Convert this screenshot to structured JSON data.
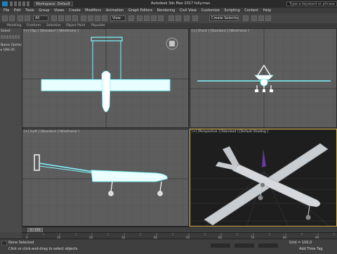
{
  "title_bar": {
    "workspace": "Workspace: Default",
    "app_title": "Autodesk 3ds Max 2017    fully.max",
    "search_placeholder": "Type a keyword or phrase"
  },
  "menu": [
    "File",
    "Edit",
    "Tools",
    "Group",
    "Views",
    "Create",
    "Modifiers",
    "Animation",
    "Graph Editors",
    "Rendering",
    "Civil View",
    "Customize",
    "Scripting",
    "Content",
    "Help"
  ],
  "toolbar": {
    "selection_filter": "All",
    "reference_coord": "View",
    "selection_set": "Create Selection Se"
  },
  "ribbon": [
    "Modeling",
    "Freeform",
    "Selection",
    "Object Paint",
    "Populate"
  ],
  "left_panel": {
    "header": "Select",
    "row1": "Name (Sorted As)",
    "row2": "UAV-35"
  },
  "viewports": {
    "top": "[+] [Top ] [Standard ] [Wireframe ]",
    "front": "[+] [Front ] [Standard ] [Wireframe ]",
    "left": "[+] [Left ] [Standard ] [Wireframe ]",
    "perspective": "[+] [Perspective ] [Standard ] [Default Shading ]"
  },
  "timeline": {
    "slider": "0 / 100"
  },
  "ruler_ticks": [
    "0",
    "5",
    "10",
    "15",
    "20",
    "25",
    "30",
    "35",
    "40",
    "45",
    "50",
    "55",
    "60",
    "65",
    "70",
    "75",
    "80",
    "85",
    "90",
    "95",
    "100"
  ],
  "status": {
    "selected": "None Selected",
    "prompt": "Click or click-and-drag to select objects",
    "grid": "Grid = 100,0",
    "add_time_tag": "Add Time Tag"
  },
  "colors": {
    "accent": "#d9b34a",
    "wire": "#7ff7ff",
    "viewport_bg": "#5d5d5d"
  }
}
